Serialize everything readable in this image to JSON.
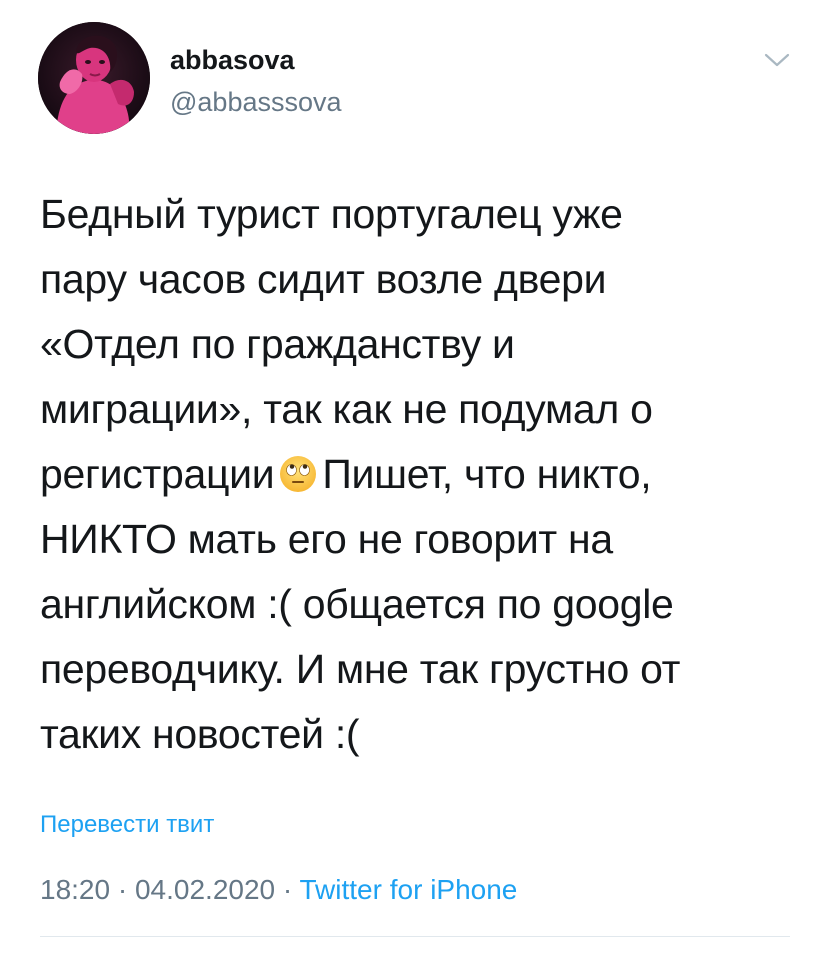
{
  "tweet": {
    "author": {
      "display_name": "abbasova",
      "handle": "@abbasssova",
      "avatar_icon": "profile-photo"
    },
    "menu_icon": "chevron-down-icon",
    "text_lines": [
      "Бедный турист португалец уже",
      "пару часов сидит возле двери",
      "«Отдел по гражданству и",
      "миграции», так как не подумал о",
      "Пишет, что никто,",
      "НИКТО мать его не говорит на",
      "английском :( общается по google",
      "переводчику. И мне так грустно от",
      "таких новостей :("
    ],
    "line5_prefix": "регистрации",
    "emoji_icon": "face-with-rolling-eyes-emoji",
    "translate_label": "Перевести твит",
    "time": "18:20",
    "separator": "·",
    "date": "04.02.2020",
    "source": "Twitter for iPhone"
  },
  "colors": {
    "text": "#14171a",
    "secondary": "#657786",
    "link": "#1da1f2",
    "divider": "#e1e8ed"
  }
}
